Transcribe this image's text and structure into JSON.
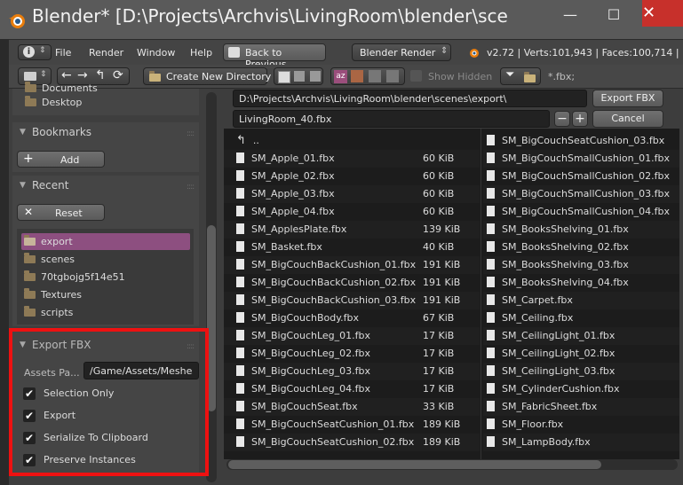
{
  "window": {
    "title": "Blender* [D:\\Projects\\Archvis\\LivingRoom\\blender\\sce",
    "minimize": "—",
    "maximize": "☐",
    "close": "✕"
  },
  "menu": {
    "items": [
      "File",
      "Render",
      "Window",
      "Help"
    ],
    "back_button": "Back to Previous",
    "render_engine": "Blender Render",
    "stats": "v2.72 | Verts:101,943 | Faces:100,714 |"
  },
  "file_header": {
    "create_dir": "Create New Directory",
    "show_hidden": "Show Hidden",
    "filter": "*.fbx;"
  },
  "system": {
    "items": [
      "Documents",
      "Desktop"
    ]
  },
  "bookmarks": {
    "heading": "Bookmarks",
    "add": "Add"
  },
  "recent": {
    "heading": "Recent",
    "reset": "Reset",
    "items": [
      "export",
      "scenes",
      "70tgbojg5f14e51",
      "Textures",
      "scripts"
    ]
  },
  "export_panel": {
    "heading": "Export FBX",
    "assets_label": "Assets Pa...",
    "assets_value": "/Game/Assets/Meshes/",
    "options": [
      "Selection Only",
      "Export",
      "Serialize To Clipboard",
      "Preserve Instances"
    ]
  },
  "path": {
    "directory": "D:\\Projects\\Archvis\\LivingRoom\\blender\\scenes\\export\\",
    "filename": "LivingRoom_40.fbx",
    "export_button": "Export FBX",
    "cancel_button": "Cancel",
    "minus": "−",
    "plus": "+"
  },
  "files": {
    "parent": "..",
    "left": [
      {
        "name": "SM_Apple_01.fbx",
        "size": "60 KiB"
      },
      {
        "name": "SM_Apple_02.fbx",
        "size": "60 KiB"
      },
      {
        "name": "SM_Apple_03.fbx",
        "size": "60 KiB"
      },
      {
        "name": "SM_Apple_04.fbx",
        "size": "60 KiB"
      },
      {
        "name": "SM_ApplesPlate.fbx",
        "size": "139 KiB"
      },
      {
        "name": "SM_Basket.fbx",
        "size": "40 KiB"
      },
      {
        "name": "SM_BigCouchBackCushion_01.fbx",
        "size": "191 KiB"
      },
      {
        "name": "SM_BigCouchBackCushion_02.fbx",
        "size": "191 KiB"
      },
      {
        "name": "SM_BigCouchBackCushion_03.fbx",
        "size": "191 KiB"
      },
      {
        "name": "SM_BigCouchBody.fbx",
        "size": "67 KiB"
      },
      {
        "name": "SM_BigCouchLeg_01.fbx",
        "size": "17 KiB"
      },
      {
        "name": "SM_BigCouchLeg_02.fbx",
        "size": "17 KiB"
      },
      {
        "name": "SM_BigCouchLeg_03.fbx",
        "size": "17 KiB"
      },
      {
        "name": "SM_BigCouchLeg_04.fbx",
        "size": "17 KiB"
      },
      {
        "name": "SM_BigCouchSeat.fbx",
        "size": "33 KiB"
      },
      {
        "name": "SM_BigCouchSeatCushion_01.fbx",
        "size": "189 KiB"
      },
      {
        "name": "SM_BigCouchSeatCushion_02.fbx",
        "size": "189 KiB"
      }
    ],
    "right": [
      "SM_BigCouchSeatCushion_03.fbx",
      "SM_BigCouchSmallCushion_01.fbx",
      "SM_BigCouchSmallCushion_02.fbx",
      "SM_BigCouchSmallCushion_03.fbx",
      "SM_BigCouchSmallCushion_04.fbx",
      "SM_BooksShelving_01.fbx",
      "SM_BooksShelving_02.fbx",
      "SM_BooksShelving_03.fbx",
      "SM_BooksShelving_04.fbx",
      "SM_Carpet.fbx",
      "SM_Ceiling.fbx",
      "SM_CeilingLight_01.fbx",
      "SM_CeilingLight_02.fbx",
      "SM_CeilingLight_03.fbx",
      "SM_CylinderCushion.fbx",
      "SM_FabricSheet.fbx",
      "SM_Floor.fbx",
      "SM_LampBody.fbx"
    ]
  },
  "colors": {
    "accent": "#9b4e7c",
    "highlight": "#e11111",
    "close": "#c7302b"
  }
}
